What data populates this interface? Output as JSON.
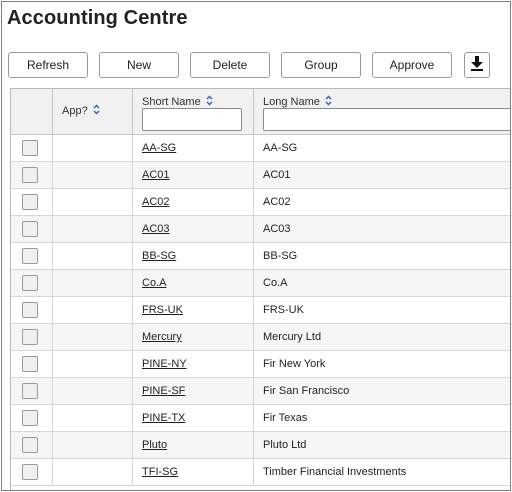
{
  "page": {
    "title": "Accounting Centre"
  },
  "toolbar": {
    "refresh_label": "Refresh",
    "new_label": "New",
    "delete_label": "Delete",
    "group_label": "Group",
    "approve_label": "Approve",
    "download_icon": "download-icon"
  },
  "grid": {
    "columns": [
      {
        "label": ""
      },
      {
        "label": "App?"
      },
      {
        "label": "Short Name"
      },
      {
        "label": "Long Name"
      }
    ],
    "rows": [
      {
        "short": "AA-SG",
        "long": "AA-SG"
      },
      {
        "short": "AC01",
        "long": "AC01"
      },
      {
        "short": "AC02",
        "long": "AC02"
      },
      {
        "short": "AC03",
        "long": "AC03"
      },
      {
        "short": "BB-SG",
        "long": "BB-SG"
      },
      {
        "short": "Co.A",
        "long": "Co.A"
      },
      {
        "short": "FRS-UK",
        "long": "FRS-UK"
      },
      {
        "short": "Mercury",
        "long": "Mercury Ltd"
      },
      {
        "short": "PINE-NY",
        "long": "Fir New York"
      },
      {
        "short": "PINE-SF",
        "long": "Fir San Francisco"
      },
      {
        "short": "PINE-TX",
        "long": "Fir Texas"
      },
      {
        "short": "Pluto",
        "long": "Pluto Ltd"
      },
      {
        "short": "TFI-SG",
        "long": "Timber Financial Investments"
      }
    ]
  },
  "colors": {
    "header_bg": "#f1f1f1",
    "alt_row_bg": "#f6f6f6",
    "sort_icon": "#2a62b5"
  }
}
